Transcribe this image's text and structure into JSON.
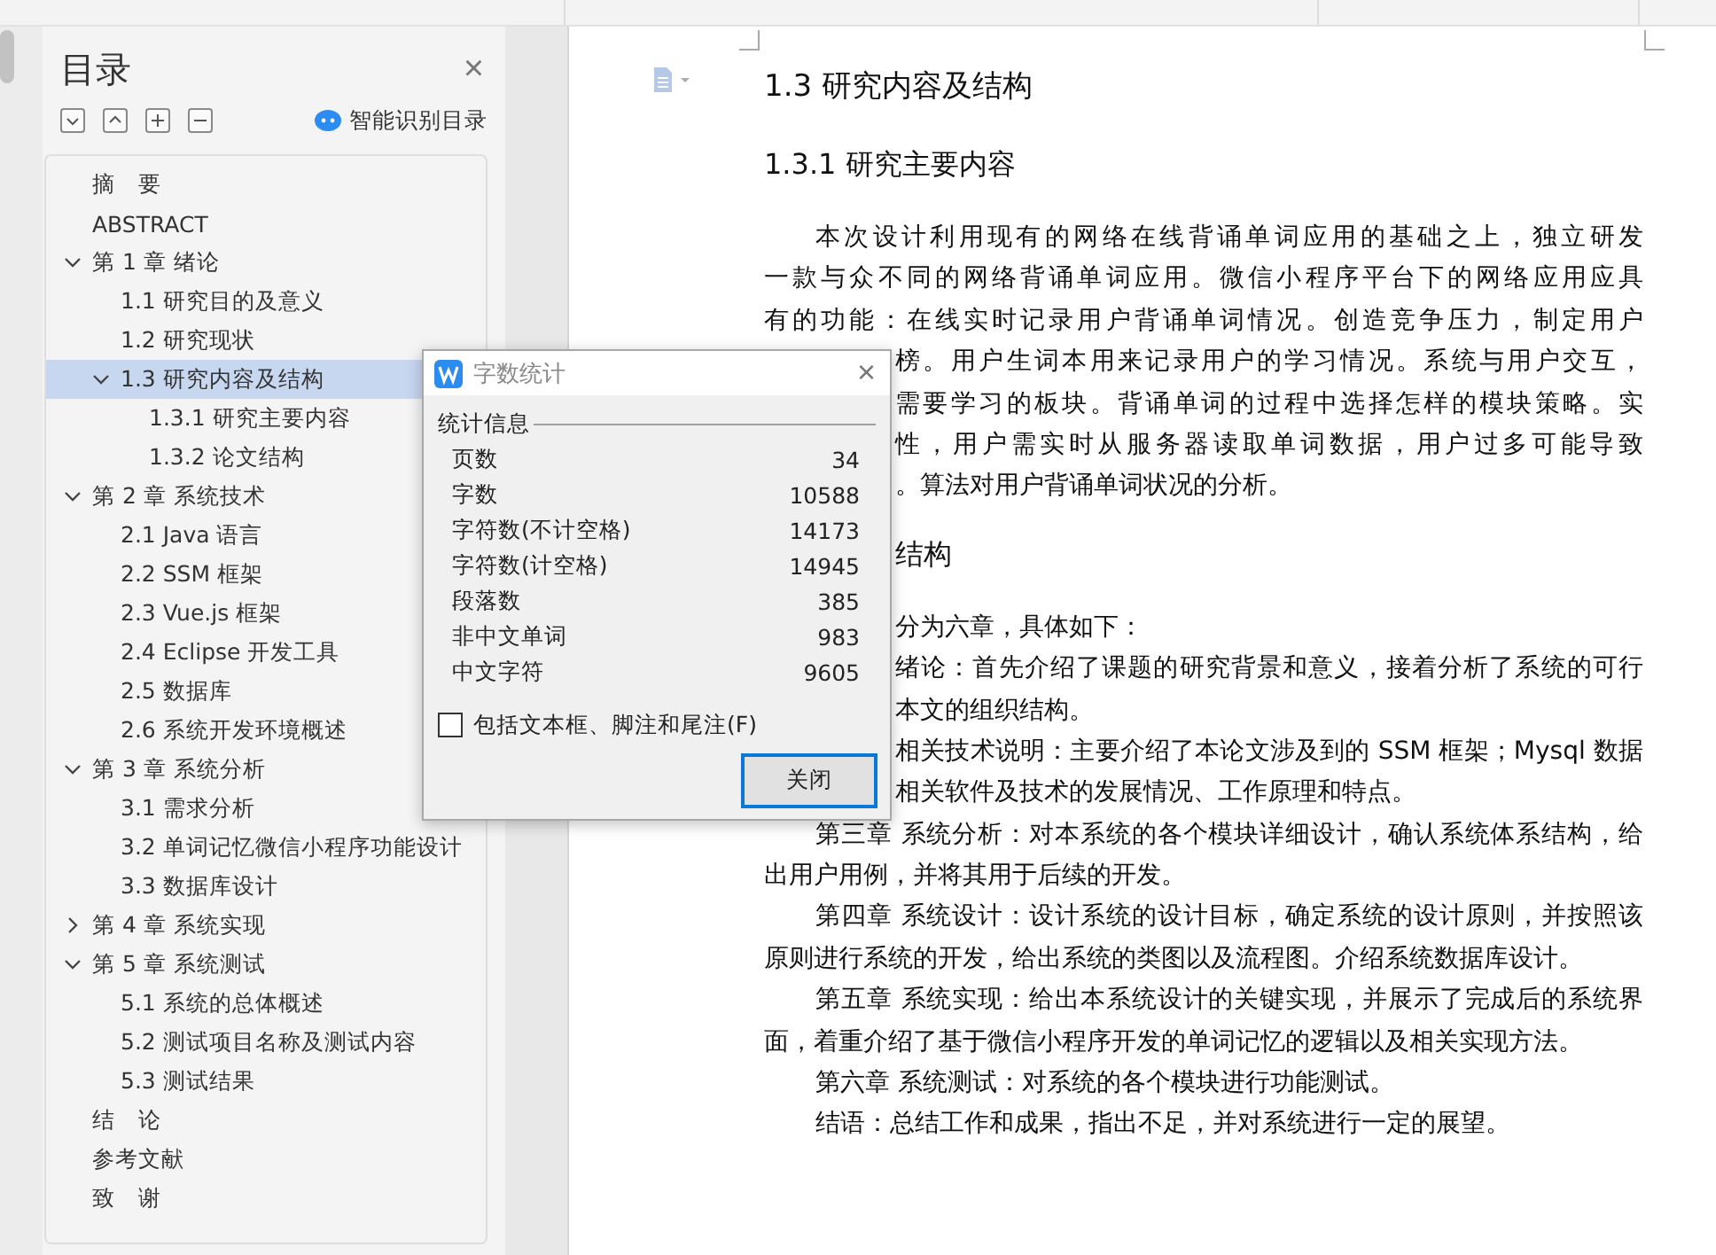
{
  "toc": {
    "title": "目录",
    "close": "×",
    "tools": [
      {
        "kind": "expand_down"
      },
      {
        "kind": "collapse_up"
      },
      {
        "kind": "plus"
      },
      {
        "kind": "minus"
      }
    ],
    "smart_button": "智能识别目录",
    "items": [
      {
        "label": "摘　要"
      },
      {
        "label": "ABSTRACT"
      },
      {
        "label": "第 1 章  绪论",
        "expanded": true,
        "selected": false,
        "children": [
          {
            "label": "1.1  研究目的及意义"
          },
          {
            "label": "1.2  研究现状"
          },
          {
            "label": "1.3 研究内容及结构",
            "expanded": true,
            "selected": true,
            "children": [
              {
                "label": "1.3.1 研究主要内容"
              },
              {
                "label": "1.3.2 论文结构"
              }
            ]
          }
        ]
      },
      {
        "label": "第 2 章  系统技术",
        "expanded": true,
        "selected": false,
        "children": [
          {
            "label": "2.1 Java 语言"
          },
          {
            "label": "2.2 SSM 框架"
          },
          {
            "label": "2.3 Vue.js 框架"
          },
          {
            "label": "2.4 Eclipse 开发工具"
          },
          {
            "label": "2.5  数据库"
          },
          {
            "label": "2.6 系统开发环境概述"
          }
        ]
      },
      {
        "label": "第 3 章  系统分析",
        "expanded": true,
        "selected": false,
        "children": [
          {
            "label": "3.1 需求分析"
          },
          {
            "label": "3.2 单词记忆微信小程序功能设计"
          },
          {
            "label": "3.3 数据库设计"
          }
        ]
      },
      {
        "label": "第 4 章  系统实现",
        "expanded": false,
        "selected": false
      },
      {
        "label": "第 5 章  系统测试",
        "expanded": true,
        "selected": false,
        "children": [
          {
            "label": "5.1 系统的总体概述"
          },
          {
            "label": "5.2 测试项目名称及测试内容"
          },
          {
            "label": "5.3 测试结果"
          }
        ]
      },
      {
        "label": "结　论"
      },
      {
        "label": "参考文献"
      },
      {
        "label": "致　谢"
      }
    ]
  },
  "document": {
    "heading": "1.3 研究内容及结构",
    "subheading": "1.3.1 研究主要内容",
    "paragraph_1": [
      {
        "kind": "indent",
        "justified": true,
        "text": "本次设计利用现有的网络在线背诵单词应用的基础之上，独立研发"
      },
      {
        "kind": "margin",
        "justified": true,
        "text": "一款与众不同的网络背诵单词应用。微信小程序平台下的网络应用应具"
      },
      {
        "kind": "margin",
        "justified": true,
        "text": "有的功能：在线实时记录用户背诵单词情况。创造竞争压力，制定用户"
      },
      {
        "kind": "covered",
        "justified": true,
        "text": "榜。用户生词本用来记录用户的学习情况。系统与用户交互，"
      },
      {
        "kind": "covered",
        "justified": true,
        "text": "需要学习的板块。背诵单词的过程中选择怎样的模块策略。实"
      },
      {
        "kind": "covered",
        "justified": true,
        "text": "性，用户需实时从服务器读取单词数据，用户过多可能导致"
      },
      {
        "kind": "covered",
        "justified": false,
        "text": "。算法对用户背诵单词状况的分析。"
      }
    ],
    "subheading_2": "结构",
    "paragraph_2": [
      {
        "kind": "covered",
        "justified": false,
        "text": "分为六章，具体如下："
      },
      {
        "kind": "covered",
        "justified": true,
        "text": "绪论：首先介绍了课题的研究背景和意义，接着分析了系统的可行"
      },
      {
        "kind": "covered",
        "justified": false,
        "text": "本文的组织结构。"
      },
      {
        "kind": "covered",
        "justified": true,
        "text": "相关技术说明：主要介绍了本论文涉及到的 SSM 框架；Mysql 数据"
      },
      {
        "kind": "covered",
        "justified": false,
        "text": "相关软件及技术的发展情况、工作原理和特点。"
      },
      {
        "kind": "indent",
        "justified": true,
        "text": "第三章  系统分析：对本系统的各个模块详细设计，确认系统体系结构，给"
      },
      {
        "kind": "margin",
        "justified": false,
        "text": "出用户用例，并将其用于后续的开发。"
      },
      {
        "kind": "indent",
        "justified": true,
        "text": "第四章  系统设计：设计系统的设计目标，确定系统的设计原则，并按照该"
      },
      {
        "kind": "margin",
        "justified": false,
        "text": "原则进行系统的开发，给出系统的类图以及流程图。介绍系统数据库设计。"
      },
      {
        "kind": "indent",
        "justified": true,
        "text": "第五章  系统实现：给出本系统设计的关键实现，并展示了完成后的系统界"
      },
      {
        "kind": "margin",
        "justified": false,
        "text": "面，着重介绍了基于微信小程序开发的单词记忆的逻辑以及相关实现方法。"
      },
      {
        "kind": "indent",
        "justified": false,
        "text": "第六章  系统测试：对系统的各个模块进行功能测试。"
      },
      {
        "kind": "indent",
        "justified": false,
        "text": " 结语：总结工作和成果，指出不足，并对系统进行一定的展望。"
      }
    ]
  },
  "dialog": {
    "title": "字数统计",
    "close": "×",
    "group": "统计信息",
    "stats": [
      {
        "label": "页数",
        "value": "34"
      },
      {
        "label": "字数",
        "value": "10588"
      },
      {
        "label": "字符数(不计空格)",
        "value": "14173"
      },
      {
        "label": "字符数(计空格)",
        "value": "14945"
      },
      {
        "label": "段落数",
        "value": "385"
      },
      {
        "label": "非中文单词",
        "value": "983"
      },
      {
        "label": "中文字符",
        "value": "9605"
      }
    ],
    "checkbox": {
      "label": "包括文本框、脚注和尾注(F)",
      "checked": false
    },
    "button": "关闭"
  }
}
